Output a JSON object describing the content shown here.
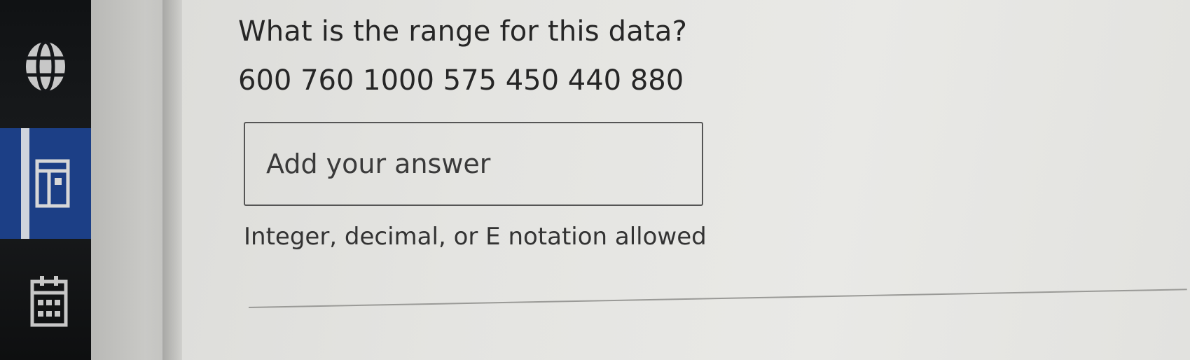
{
  "question": {
    "title": "What is the range for this data?",
    "data_values": "600 760 1000 575 450 440 880"
  },
  "answer": {
    "placeholder": "Add your answer",
    "value": "",
    "hint": "Integer, decimal, or E notation allowed"
  },
  "sidebar": {
    "items": [
      {
        "icon": "globe-icon",
        "active": false
      },
      {
        "icon": "assignment-icon",
        "active": true
      },
      {
        "icon": "calendar-icon",
        "active": false
      }
    ]
  },
  "colors": {
    "rail": "#15171a",
    "active_item": "#1c3f86",
    "text": "#262626"
  }
}
